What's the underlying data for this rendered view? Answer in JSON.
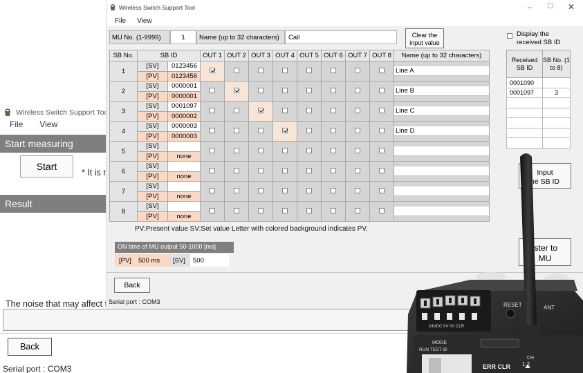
{
  "colors": {
    "pv_bg": "#f7d9c5",
    "header_bar": "#7f7f7f",
    "device_body": "#2b2b2b"
  },
  "background_window": {
    "title": "Wireless Switch Support Tool",
    "menu": [
      "File",
      "View"
    ],
    "start_measuring": "Start measuring",
    "start_button": "Start",
    "note": "* It is n",
    "result": "Result",
    "noise_label": "The noise that may affect th",
    "back_button": "Back",
    "serial_port": "Serial port :  COM3"
  },
  "main_window": {
    "title": "Wireless Switch Support Tool",
    "menu": [
      "File",
      "View"
    ],
    "mu_label": "MU No. (1-9999)",
    "mu_value": "1",
    "name_label": "Name (up to 32 characters)",
    "name_value": "Call",
    "clear_button_line1": "Clear the",
    "clear_button_line2": "input value",
    "table_headers": {
      "sb_no": "SB No.",
      "sb_id": "SB ID",
      "outs": [
        "OUT 1",
        "OUT 2",
        "OUT 3",
        "OUT 4",
        "OUT 5",
        "OUT 6",
        "OUT 7",
        "OUT 8"
      ],
      "name": "Name (up to 32 characters)"
    },
    "sv_tag": "[SV]",
    "pv_tag": "[PV]",
    "rows": [
      {
        "no": "1",
        "sv": "0123456",
        "pv": "0123456",
        "outs": [
          true,
          false,
          false,
          false,
          false,
          false,
          false,
          false
        ],
        "name": "Line A"
      },
      {
        "no": "2",
        "sv": "0000001",
        "pv": "0000001",
        "outs": [
          false,
          true,
          false,
          false,
          false,
          false,
          false,
          false
        ],
        "name": "Line B"
      },
      {
        "no": "3",
        "sv": "0001097",
        "pv": "0000002",
        "outs": [
          false,
          false,
          true,
          false,
          false,
          false,
          false,
          false
        ],
        "name": "Line C"
      },
      {
        "no": "4",
        "sv": "0000003",
        "pv": "0000003",
        "outs": [
          false,
          false,
          false,
          true,
          false,
          false,
          false,
          false
        ],
        "name": "Line D"
      },
      {
        "no": "5",
        "sv": "",
        "pv": "none",
        "outs": [
          false,
          false,
          false,
          false,
          false,
          false,
          false,
          false
        ],
        "name": ""
      },
      {
        "no": "6",
        "sv": "",
        "pv": "none",
        "outs": [
          false,
          false,
          false,
          false,
          false,
          false,
          false,
          false
        ],
        "name": ""
      },
      {
        "no": "7",
        "sv": "",
        "pv": "none",
        "outs": [
          false,
          false,
          false,
          false,
          false,
          false,
          false,
          false
        ],
        "name": ""
      },
      {
        "no": "8",
        "sv": "",
        "pv": "none",
        "outs": [
          false,
          false,
          false,
          false,
          false,
          false,
          false,
          false
        ],
        "name": ""
      }
    ],
    "legend": "PV:Present value  SV:Set value    Letter with colored background indicates PV.",
    "ontime_header": "ON time of MU output 50-1000 [ms]",
    "ontime_pv_label": "[PV]",
    "ontime_pv_value": "500 ms",
    "ontime_sv_label": "[SV]",
    "ontime_sv_value": "500",
    "back_button": "Back",
    "serial_port": "Serial port :  COM3",
    "display_sb_id_line1": "Display the",
    "display_sb_id_line2": "received SB ID",
    "received_header_id": "Received SB ID",
    "received_header_no": "SB No. (1 to 8)",
    "received_rows": [
      {
        "id": "0001090",
        "no": ""
      },
      {
        "id": "0001097",
        "no": "3"
      },
      {
        "id": "",
        "no": ""
      },
      {
        "id": "",
        "no": ""
      },
      {
        "id": "",
        "no": ""
      },
      {
        "id": "",
        "no": ""
      },
      {
        "id": "",
        "no": ""
      }
    ],
    "input_sb_button_line1": "Input",
    "input_sb_button_line2": "he SB ID",
    "register_button_line1": "ister to",
    "register_button_line2": "MU"
  },
  "device": {
    "reset_label": "RESET",
    "ant_label": "ANT",
    "mode_label": "MODE",
    "mode_positions": "RUN  TEST  ID",
    "ch_label": "CH",
    "err_clr_label": "ERR CLR",
    "ch_numbers": "1   2",
    "terminal_labels": "24VDC  0V  0V  CLR"
  }
}
